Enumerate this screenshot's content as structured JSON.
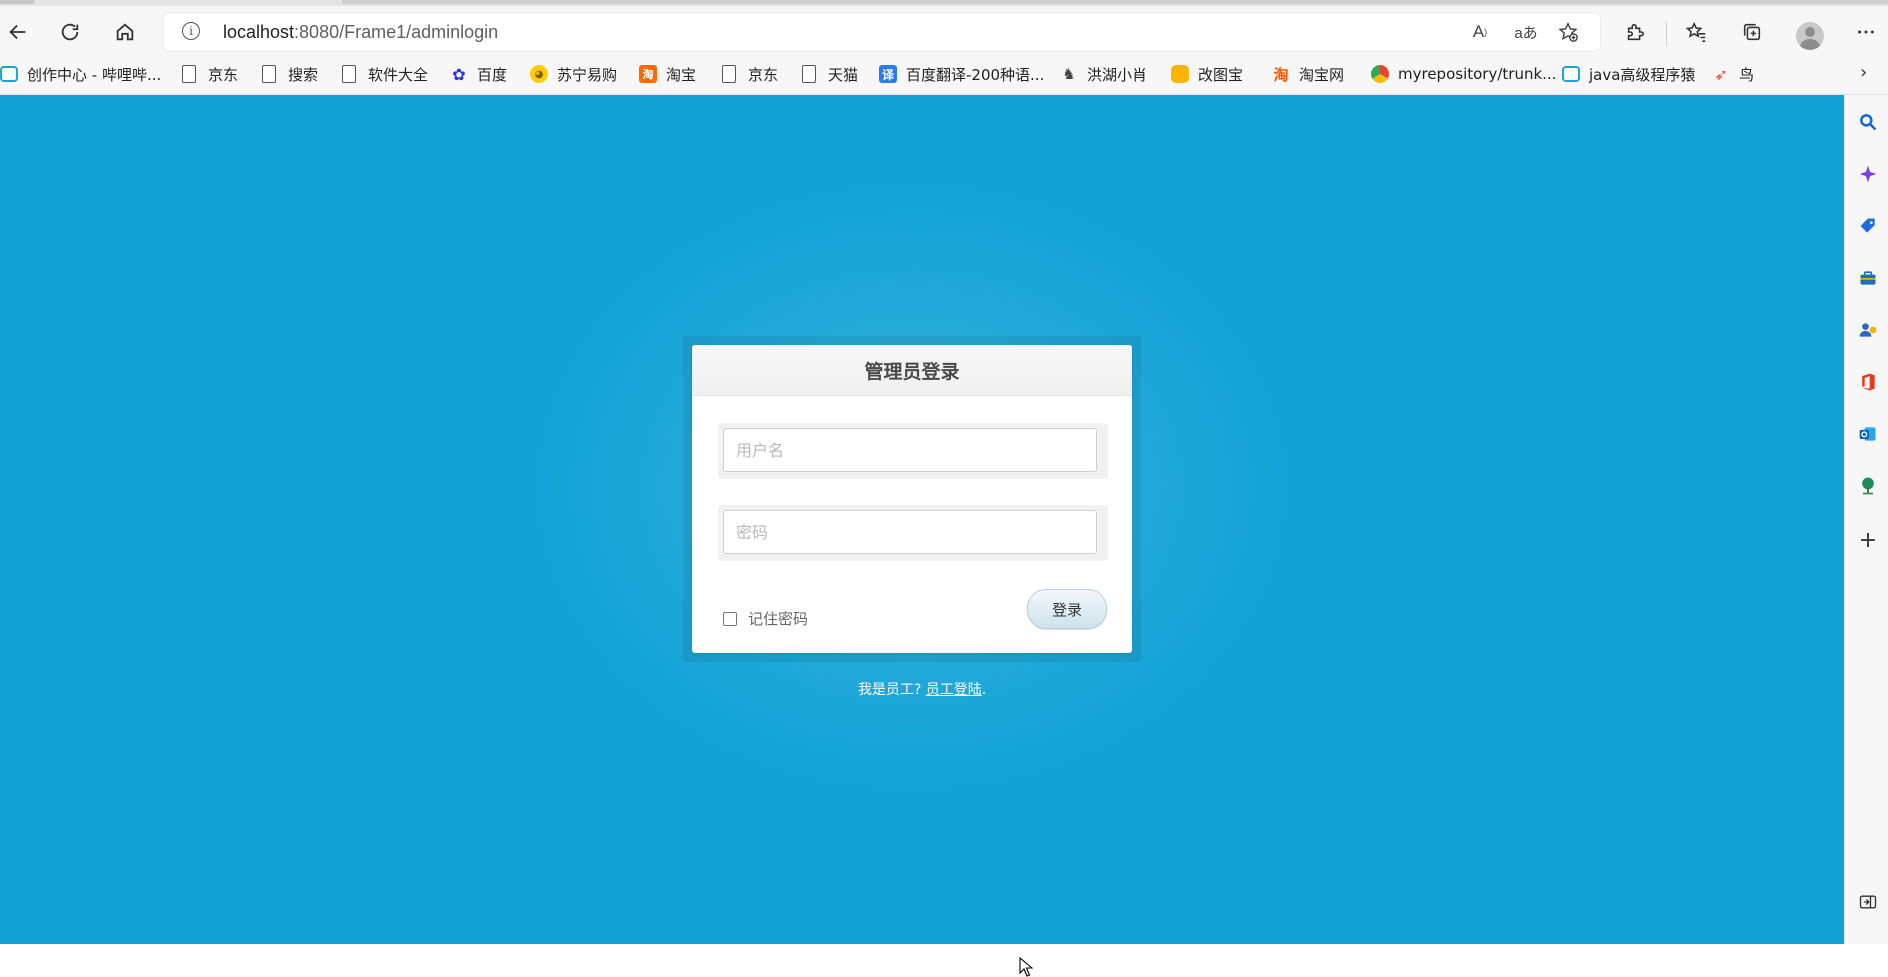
{
  "browser": {
    "url_host": "localhost",
    "url_rest": ":8080/Frame1/adminlogin",
    "read_aloud_label": "A",
    "translate_label": "aあ"
  },
  "bookmarks": [
    {
      "label": "创作中心 - 哔哩哔...",
      "icon": "bilibili-icon"
    },
    {
      "label": "京东",
      "icon": "page-icon"
    },
    {
      "label": "搜索",
      "icon": "page-icon"
    },
    {
      "label": "软件大全",
      "icon": "page-icon"
    },
    {
      "label": "百度",
      "icon": "baidu-icon"
    },
    {
      "label": "苏宁易购",
      "icon": "suning-icon"
    },
    {
      "label": "淘宝",
      "icon": "taobao-icon"
    },
    {
      "label": "京东",
      "icon": "page-icon"
    },
    {
      "label": "天猫",
      "icon": "page-icon"
    },
    {
      "label": "百度翻译-200种语...",
      "icon": "fanyi-icon"
    },
    {
      "label": "洪湖小肖",
      "icon": "hong-icon"
    },
    {
      "label": "改图宝",
      "icon": "gaitu-icon"
    },
    {
      "label": "淘宝网",
      "icon": "taobao-icon"
    },
    {
      "label": "myrepository/trunk...",
      "icon": "repo-icon"
    },
    {
      "label": "java高级程序猿",
      "icon": "bilibili-icon"
    },
    {
      "label": "鸟",
      "icon": "bird-icon"
    }
  ],
  "login": {
    "title": "管理员登录",
    "username_placeholder": "用户名",
    "password_placeholder": "密码",
    "remember_label": "记住密码",
    "submit_label": "登录",
    "footer_prefix": "我是员工? ",
    "footer_link": "员工登陆",
    "footer_suffix": "."
  },
  "colors": {
    "background": "#11a1d5",
    "background_center": "#3cb4dd"
  }
}
